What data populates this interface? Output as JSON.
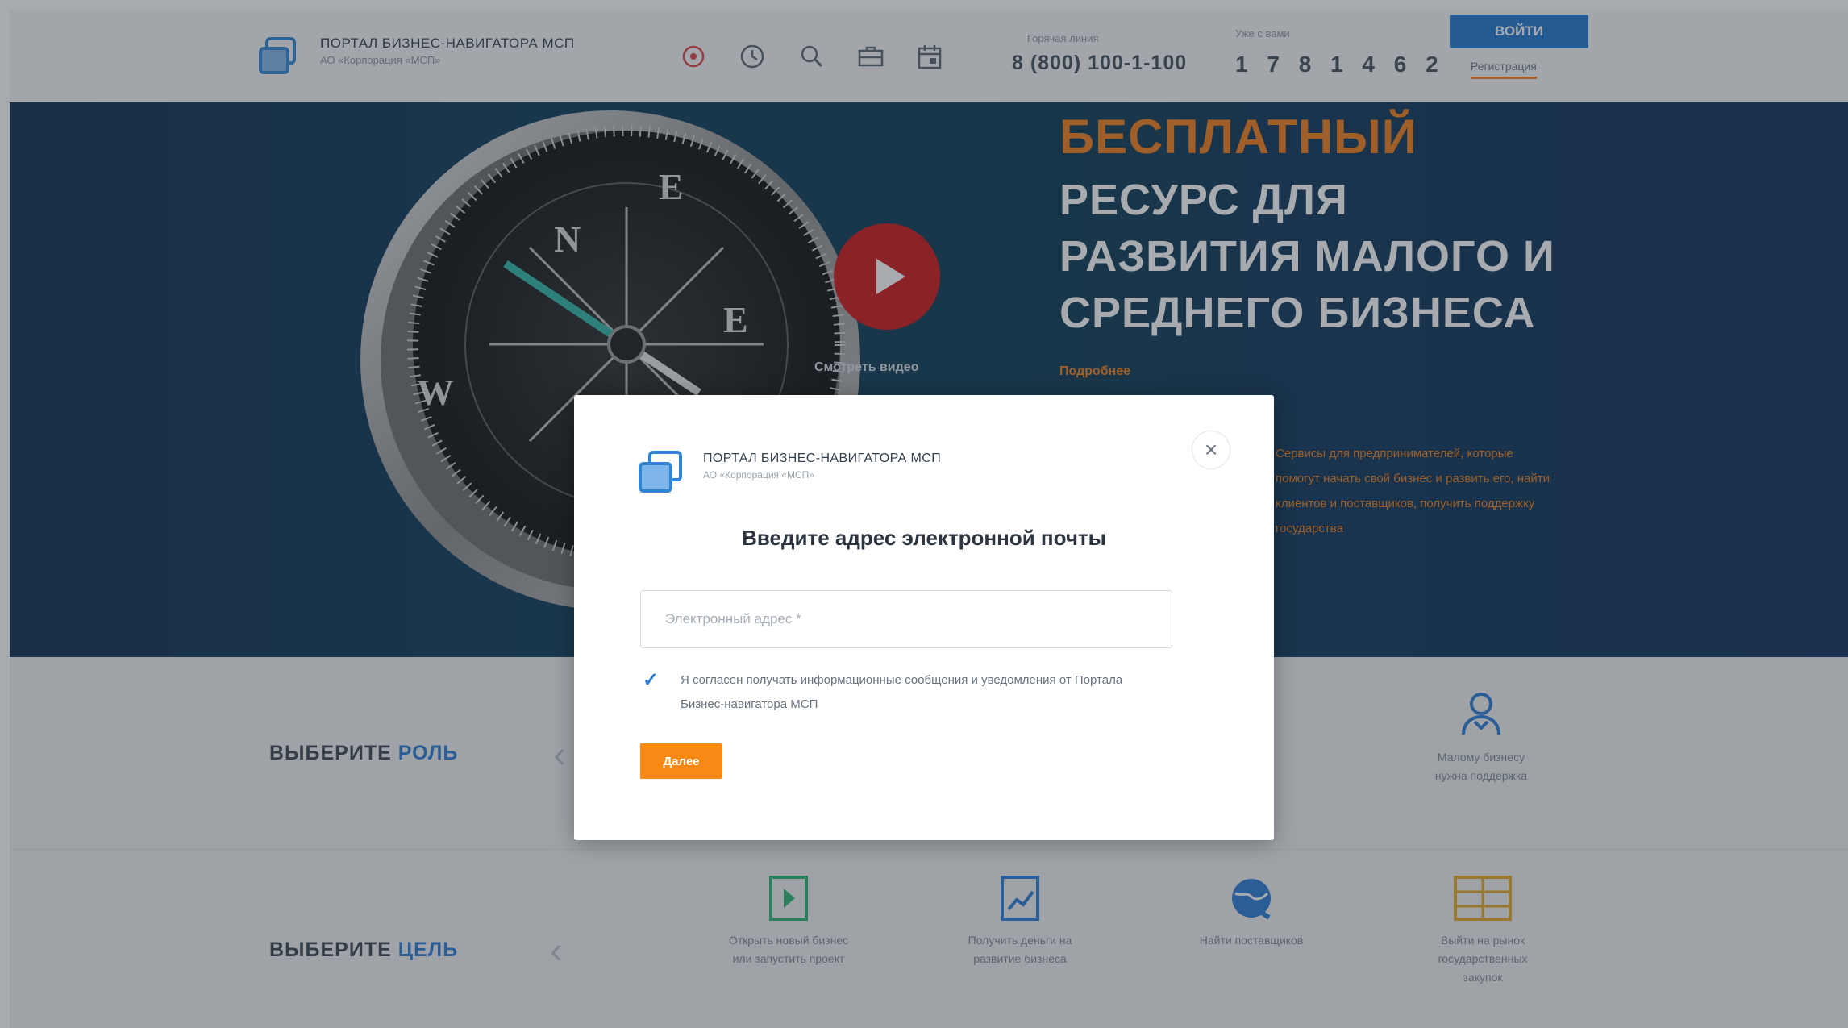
{
  "header": {
    "logo_title": "ПОРТАЛ БИЗНЕС-НАВИГАТОРА МСП",
    "logo_subtitle": "АО «Корпорация «МСП»",
    "icons": [
      "accessibility-icon",
      "clock-icon",
      "search-icon",
      "briefcase-icon",
      "calendar-icon"
    ],
    "hotline_label": "Горячая линия",
    "hotline_number": "8 (800) 100-1-100",
    "days_label": "Уже с вами",
    "days_counter": "1 7 8 1 4 6 2",
    "login_label": "ВОЙТИ",
    "register_label": "Регистрация"
  },
  "hero": {
    "accent": "БЕСПЛАТНЫЙ",
    "lines": [
      "РЕСУРС ДЛЯ",
      "РАЗВИТИЯ МАЛОГО И",
      "СРЕДНЕГО БИЗНЕСА"
    ],
    "details_link": "Подробнее",
    "watch_video": "Смотреть видео",
    "description": "Сервисы для предпринимателей, которые помогут начать свой бизнес и развить его, найти клиентов и поставщиков, получить поддержку государства"
  },
  "roles": {
    "title_plain": "ВЫБЕРИТЕ",
    "title_accent": "РОЛЬ",
    "item_label": "Малому бизнесу нужна поддержка"
  },
  "goals": {
    "title_plain": "ВЫБЕРИТЕ",
    "title_accent": "ЦЕЛЬ",
    "items": [
      {
        "label": "Открыть новый бизнес или запустить проект",
        "icon": "startup-icon"
      },
      {
        "label": "Получить деньги на развитие бизнеса",
        "icon": "growth-chart-icon"
      },
      {
        "label": "Найти поставщиков",
        "icon": "globe-icon"
      },
      {
        "label": "Выйти на рынок государственных закупок",
        "icon": "documents-icon"
      }
    ]
  },
  "modal": {
    "logo_title": "ПОРТАЛ БИЗНЕС-НАВИГАТОРА МСП",
    "logo_subtitle": "АО «Корпорация «МСП»",
    "heading": "Введите адрес электронной почты",
    "email_placeholder": "Электронный адрес *",
    "consent_text": "Я согласен получать информационные сообщения и уведомления от Портала Бизнес-навигатора МСП",
    "consent_checked": true,
    "submit_label": "Далее"
  },
  "colors": {
    "accent_blue": "#1f78d1",
    "accent_orange": "#f37f1a",
    "play_red": "#cc1818"
  }
}
